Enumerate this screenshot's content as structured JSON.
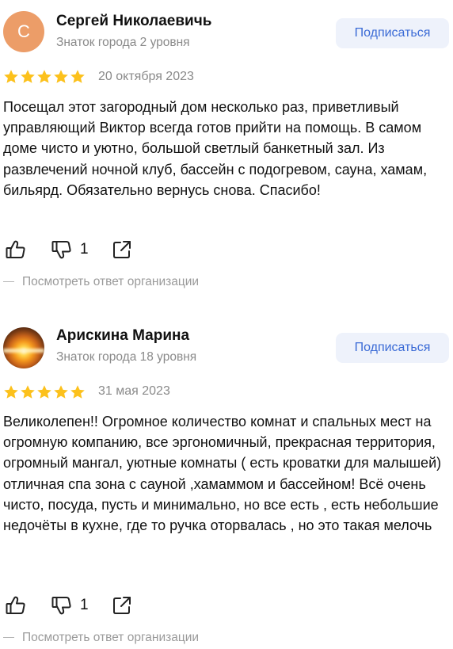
{
  "reviews": [
    {
      "avatar_letter": "С",
      "avatar_color": "#ec9d68",
      "name": "Сергей Николаевичь",
      "level": "Знаток города 2 уровня",
      "subscribe_label": "Подписаться",
      "rating": 5,
      "date": "20 октября 2023",
      "text": "Посещал этот загородный дом несколько раз, приветливый управляющий Виктор всегда готов прийти на помощь. В самом доме чисто и уютно, большой светлый банкетный зал. Из развлечений ночной клуб, бассейн с подогревом, сауна, хамам, бильярд. Обязательно вернусь снова. Спасибо!",
      "dislike_count": "1",
      "reply_label": "Посмотреть ответ организации"
    },
    {
      "avatar_letter": "",
      "name": "Арискина Марина",
      "level": "Знаток города 18 уровня",
      "subscribe_label": "Подписаться",
      "rating": 5,
      "date": "31 мая 2023",
      "text": "Великолепен!! Огромное количество комнат и спальных мест на огромную компанию, все эргономичный, прекрасная территория, огромный мангал, уютные комнаты ( есть кроватки для малышей) отличная спа зона с сауной ,хамаммом и бассейном! Всё очень чисто, посуда, пусть и минимально, но все есть , есть небольшие недочёты в кухне, где то ручка оторвалась , но это такая мелочь",
      "dislike_count": "1",
      "reply_label": "Посмотреть ответ организации"
    }
  ],
  "colors": {
    "star": "#fcc11c",
    "accent_text": "#3b6bd6",
    "subscribe_bg": "#eef2fb",
    "muted": "#8a8a8a"
  },
  "icons": [
    "thumbs-up-icon",
    "thumbs-down-icon",
    "share-icon",
    "star-icon"
  ]
}
